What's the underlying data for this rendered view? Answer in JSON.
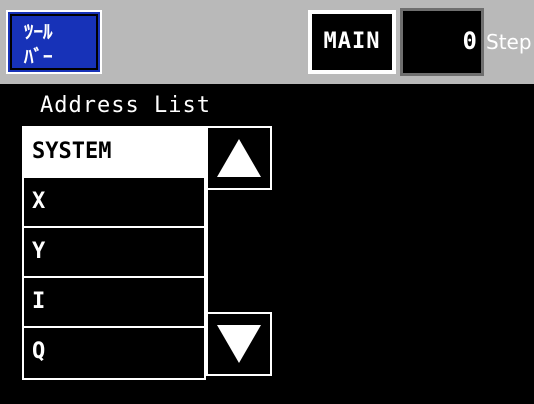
{
  "topbar": {
    "tool_button": {
      "icon": "tool-box-icon",
      "text_top": "ﾂｰﾙ",
      "text_bottom": "ﾊﾞｰ"
    },
    "program_name": "MAIN",
    "step_value": "0",
    "step_label": "Step"
  },
  "address_list": {
    "title": "Address List",
    "selected": "SYSTEM",
    "items": [
      {
        "label": "SYSTEM"
      },
      {
        "label": "X"
      },
      {
        "label": "Y"
      },
      {
        "label": "I"
      },
      {
        "label": "Q"
      }
    ],
    "scroll_up_icon": "up-triangle-icon",
    "scroll_down_icon": "down-triangle-icon"
  },
  "colors": {
    "background": "#000000",
    "topbar": "#b9b9b9",
    "tool_button": "#1732b8",
    "foreground": "#ffffff"
  }
}
